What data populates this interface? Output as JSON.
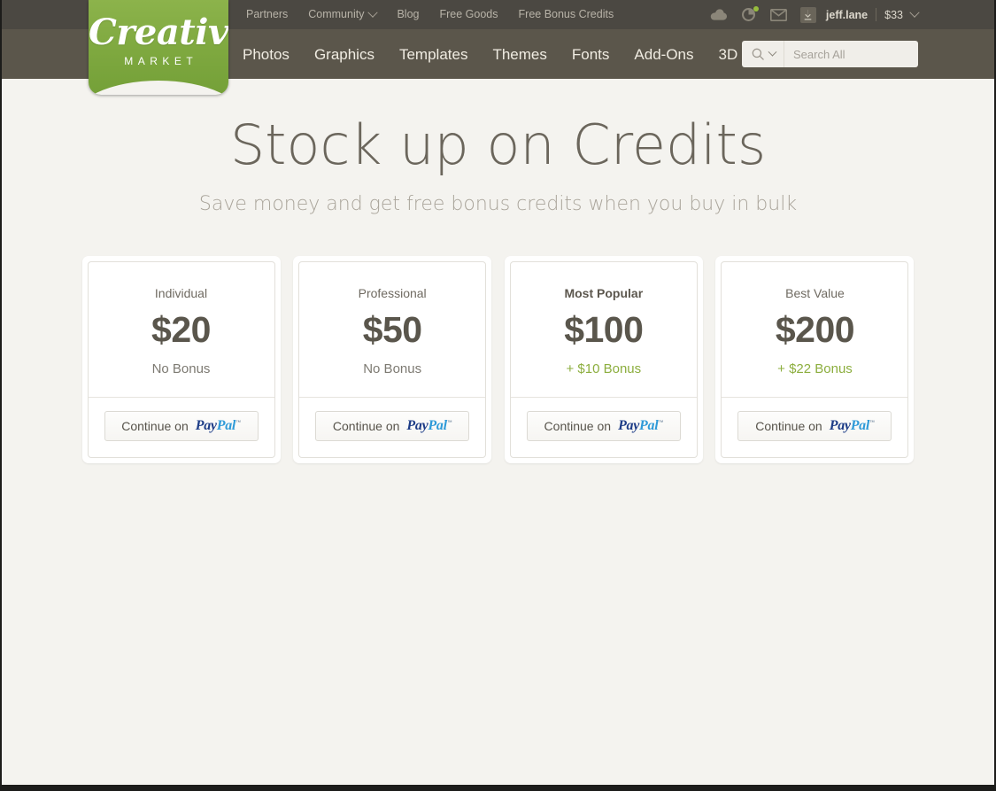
{
  "header": {
    "utility_nav": [
      {
        "label": "Partners",
        "icon": null
      },
      {
        "label": "Community",
        "icon": "chevron-down-icon"
      },
      {
        "label": "Blog",
        "icon": null
      },
      {
        "label": "Free Goods",
        "icon": null
      },
      {
        "label": "Free Bonus Credits",
        "icon": null
      }
    ],
    "utility_icons": [
      {
        "name": "cloud-icon",
        "badge": false
      },
      {
        "name": "notifications-icon",
        "badge": true
      },
      {
        "name": "messages-envelope-icon",
        "badge": false
      }
    ],
    "account": {
      "avatar_icon": "downloads-arrow-icon",
      "username": "jeff.lane",
      "balance": "$33",
      "chevron": "chevron-down-icon"
    },
    "logo": {
      "word": "Creative",
      "sub": "MARKET",
      "color": "#7ea83f"
    },
    "main_nav": [
      "Photos",
      "Graphics",
      "Templates",
      "Themes",
      "Fonts",
      "Add-Ons",
      "3D"
    ],
    "search": {
      "scope_icon": "search-icon",
      "scope_chevron": "chevron-down-icon",
      "placeholder": "Search All",
      "value": ""
    }
  },
  "hero": {
    "title": "Stock up on Credits",
    "subtitle": "Save money and get free bonus credits when you buy in bulk"
  },
  "pricing": {
    "bonus_color": "#8cae3e",
    "plans": [
      {
        "label": "Individual",
        "highlight": false,
        "price": "$20",
        "bonus": "No Bonus",
        "bonus_is_green": false,
        "cta_text": "Continue on",
        "cta_brand_a": "Pay",
        "cta_brand_b": "Pal"
      },
      {
        "label": "Professional",
        "highlight": false,
        "price": "$50",
        "bonus": "No Bonus",
        "bonus_is_green": false,
        "cta_text": "Continue on",
        "cta_brand_a": "Pay",
        "cta_brand_b": "Pal"
      },
      {
        "label": "Most Popular",
        "highlight": true,
        "price": "$100",
        "bonus": "+ $10 Bonus",
        "bonus_is_green": true,
        "cta_text": "Continue on",
        "cta_brand_a": "Pay",
        "cta_brand_b": "Pal"
      },
      {
        "label": "Best Value",
        "highlight": false,
        "price": "$200",
        "bonus": "+ $22 Bonus",
        "bonus_is_green": true,
        "cta_text": "Continue on",
        "cta_brand_a": "Pay",
        "cta_brand_b": "Pal"
      }
    ]
  }
}
